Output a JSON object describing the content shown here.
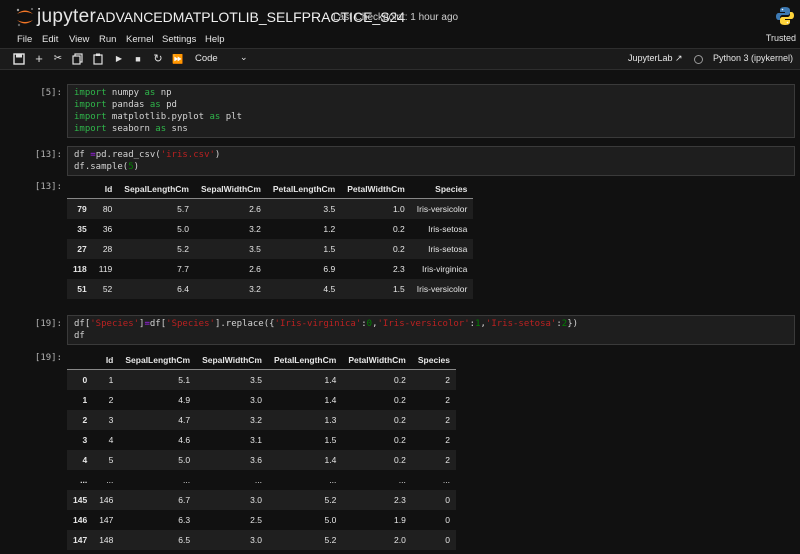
{
  "header": {
    "brand": "jupyter",
    "notebook_title": "ADVANCEDMATPLOTLIB_SELFPRACTICE_S24",
    "checkpoint": "Last Checkpoint: 1 hour ago"
  },
  "menu": {
    "items": [
      "File",
      "Edit",
      "View",
      "Run",
      "Kernel",
      "Settings",
      "Help"
    ],
    "trusted": "Trusted"
  },
  "toolbar": {
    "cell_type": "Code",
    "jupyterlab": "JupyterLab",
    "kernel": "Python 3 (ipykernel)"
  },
  "cells": [
    {
      "prompt": "[5]:",
      "lines": [
        "import numpy as np",
        "import pandas as pd",
        "import matplotlib.pyplot as plt",
        "import seaborn as sns"
      ]
    },
    {
      "prompt": "[13]:",
      "lines": [
        "df =pd.read_csv('iris.csv')",
        "df.sample(5)"
      ],
      "output_prompt": "[13]:",
      "output": {
        "columns": [
          "Id",
          "SepalLengthCm",
          "SepalWidthCm",
          "PetalLengthCm",
          "PetalWidthCm",
          "Species"
        ],
        "rows": [
          {
            "index": "79",
            "cells": [
              "80",
              "5.7",
              "2.6",
              "3.5",
              "1.0",
              "Iris-versicolor"
            ]
          },
          {
            "index": "35",
            "cells": [
              "36",
              "5.0",
              "3.2",
              "1.2",
              "0.2",
              "Iris-setosa"
            ]
          },
          {
            "index": "27",
            "cells": [
              "28",
              "5.2",
              "3.5",
              "1.5",
              "0.2",
              "Iris-setosa"
            ]
          },
          {
            "index": "118",
            "cells": [
              "119",
              "7.7",
              "2.6",
              "6.9",
              "2.3",
              "Iris-virginica"
            ]
          },
          {
            "index": "51",
            "cells": [
              "52",
              "6.4",
              "3.2",
              "4.5",
              "1.5",
              "Iris-versicolor"
            ]
          }
        ]
      }
    },
    {
      "prompt": "[19]:",
      "lines": [
        "df['Species']=df['Species'].replace({'Iris-virginica':0,'Iris-versicolor':1,'Iris-setosa':2})",
        "df"
      ],
      "output_prompt": "[19]:",
      "output": {
        "columns": [
          "Id",
          "SepalLengthCm",
          "SepalWidthCm",
          "PetalLengthCm",
          "PetalWidthCm",
          "Species"
        ],
        "rows": [
          {
            "index": "0",
            "cells": [
              "1",
              "5.1",
              "3.5",
              "1.4",
              "0.2",
              "2"
            ]
          },
          {
            "index": "1",
            "cells": [
              "2",
              "4.9",
              "3.0",
              "1.4",
              "0.2",
              "2"
            ]
          },
          {
            "index": "2",
            "cells": [
              "3",
              "4.7",
              "3.2",
              "1.3",
              "0.2",
              "2"
            ]
          },
          {
            "index": "3",
            "cells": [
              "4",
              "4.6",
              "3.1",
              "1.5",
              "0.2",
              "2"
            ]
          },
          {
            "index": "4",
            "cells": [
              "5",
              "5.0",
              "3.6",
              "1.4",
              "0.2",
              "2"
            ]
          },
          {
            "index": "...",
            "cells": [
              "...",
              "...",
              "...",
              "...",
              "...",
              "..."
            ]
          },
          {
            "index": "145",
            "cells": [
              "146",
              "6.7",
              "3.0",
              "5.2",
              "2.3",
              "0"
            ]
          },
          {
            "index": "146",
            "cells": [
              "147",
              "6.3",
              "2.5",
              "5.0",
              "1.9",
              "0"
            ]
          },
          {
            "index": "147",
            "cells": [
              "148",
              "6.5",
              "3.0",
              "5.2",
              "2.0",
              "0"
            ]
          }
        ]
      }
    }
  ]
}
